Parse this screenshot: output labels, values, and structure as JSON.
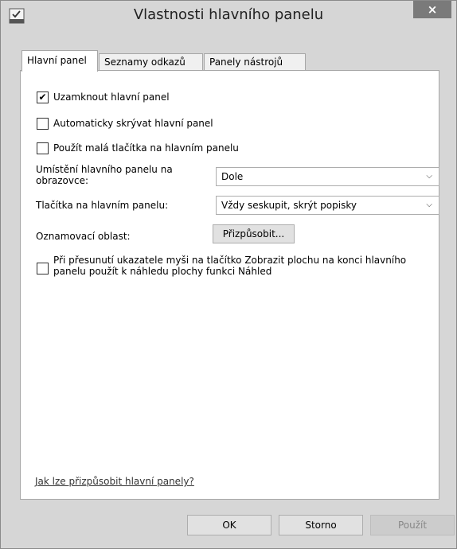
{
  "window": {
    "title": "Vlastnosti hlavního panelu",
    "close_label": "×"
  },
  "tabs": [
    {
      "label": "Hlavní panel",
      "active": true
    },
    {
      "label": "Seznamy odkazů",
      "active": false
    },
    {
      "label": "Panely nástrojů",
      "active": false
    }
  ],
  "options": {
    "lock_taskbar": {
      "label": "Uzamknout hlavní panel",
      "checked": true,
      "mark": "✔"
    },
    "auto_hide": {
      "label": "Automaticky skrývat hlavní panel",
      "checked": false
    },
    "small_buttons": {
      "label": "Použít malá tlačítka na hlavním panelu",
      "checked": false
    },
    "peek": {
      "label": "Při přesunutí ukazatele myši na tlačítko Zobrazit plochu na konci hlavního panelu použít k náhledu plochy funkci Náhled",
      "checked": false
    }
  },
  "location": {
    "label": "Umístění hlavního panelu na obrazovce:",
    "value": "Dole"
  },
  "taskbar_buttons": {
    "label": "Tlačítka na hlavním panelu:",
    "value": "Vždy seskupit, skrýt popisky"
  },
  "notification_area": {
    "label": "Oznamovací oblast:",
    "button_label": "Přizpůsobit..."
  },
  "help_link": "Jak lze přizpůsobit hlavní panely?",
  "buttons": {
    "ok": "OK",
    "cancel": "Storno",
    "apply": "Použít"
  },
  "icons": {
    "dropdown": "chevron-down-icon",
    "app": "taskbar-properties-icon"
  }
}
